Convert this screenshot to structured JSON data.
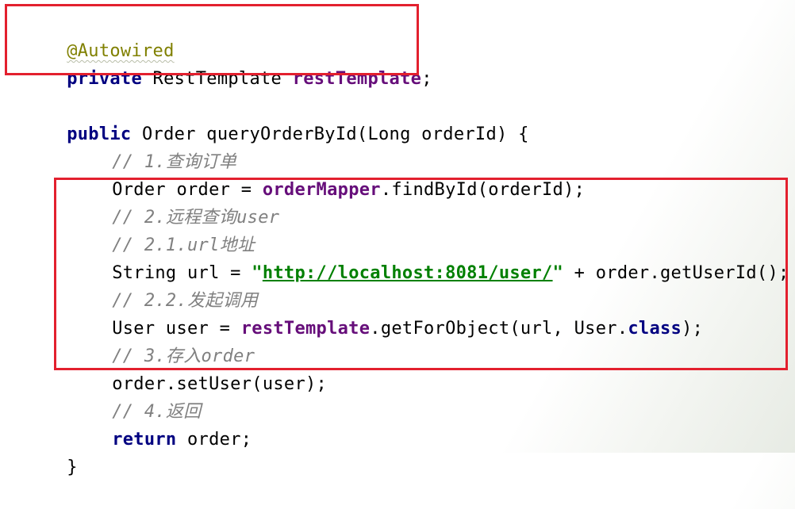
{
  "code": {
    "annotation": "@Autowired",
    "field_decl": {
      "kw_private": "private",
      "type": " RestTemplate ",
      "name": "restTemplate",
      "semi": ";"
    },
    "method_sig": {
      "kw_public": "public",
      "rest": " Order queryOrderById(Long orderId) {"
    },
    "comment_1": "// 1.查询订单",
    "line_order": {
      "pre": "Order order = ",
      "field": "orderMapper",
      "post": ".findById(orderId);"
    },
    "comment_2": "// 2.远程查询user",
    "comment_2_1": "// 2.1.url地址",
    "line_url": {
      "pre": "String url = ",
      "quote_open": "\"",
      "url": "http://localhost:8081/user/",
      "quote_close": "\"",
      "post": " + order.getUserId();"
    },
    "comment_2_2": "// 2.2.发起调用",
    "line_user": {
      "pre": "User user = ",
      "field": "restTemplate",
      "mid": ".getForObject(url, User.",
      "kw_class": "class",
      "post": ");"
    },
    "comment_3": "// 3.存入order",
    "line_set": "order.setUser(user);",
    "comment_4": "// 4.返回",
    "line_return": {
      "kw_return": "return",
      "post": " order;"
    },
    "closing_brace": "}"
  },
  "colors": {
    "highlight_border": "#e3202e",
    "keyword": "#000080",
    "field": "#660e7a",
    "comment": "#808080",
    "string": "#008000",
    "annotation": "#808000"
  }
}
